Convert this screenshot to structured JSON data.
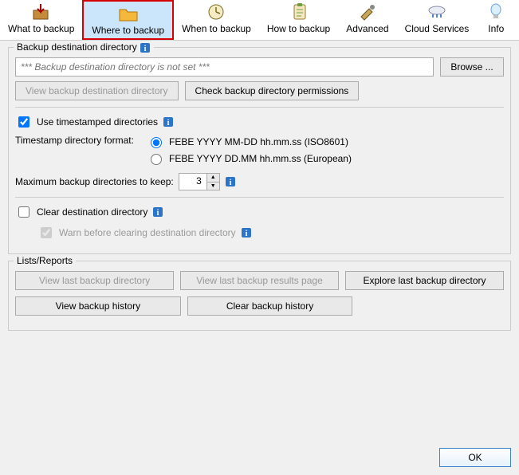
{
  "tabs": [
    {
      "label": "What to backup"
    },
    {
      "label": "Where to backup",
      "selected": true
    },
    {
      "label": "When to backup"
    },
    {
      "label": "How to backup"
    },
    {
      "label": "Advanced"
    },
    {
      "label": "Cloud Services"
    },
    {
      "label": "Info"
    }
  ],
  "dest": {
    "group_title": "Backup destination directory",
    "path_placeholder": "*** Backup destination directory is not set ***",
    "browse": "Browse ...",
    "view_dir": "View backup destination directory",
    "check_perms": "Check backup directory permissions",
    "use_timestamped": "Use timestamped directories",
    "use_timestamped_checked": true,
    "ts_format_label": "Timestamp directory format:",
    "ts_format_iso": "FEBE YYYY MM-DD hh.mm.ss (ISO8601)",
    "ts_format_eu": "FEBE YYYY DD.MM hh.mm.ss (European)",
    "ts_format_value": "iso",
    "max_keep_label": "Maximum backup directories to keep:",
    "max_keep_value": "3",
    "clear_dir": "Clear destination directory",
    "clear_dir_checked": false,
    "warn_clear": "Warn before clearing destination directory",
    "warn_clear_checked": true
  },
  "lists": {
    "group_title": "Lists/Reports",
    "view_last_dir": "View last backup directory",
    "view_last_results": "View last backup results page",
    "explore_last_dir": "Explore last backup directory",
    "view_hist": "View backup history",
    "clear_hist": "Clear backup history"
  },
  "footer": {
    "ok": "OK"
  }
}
